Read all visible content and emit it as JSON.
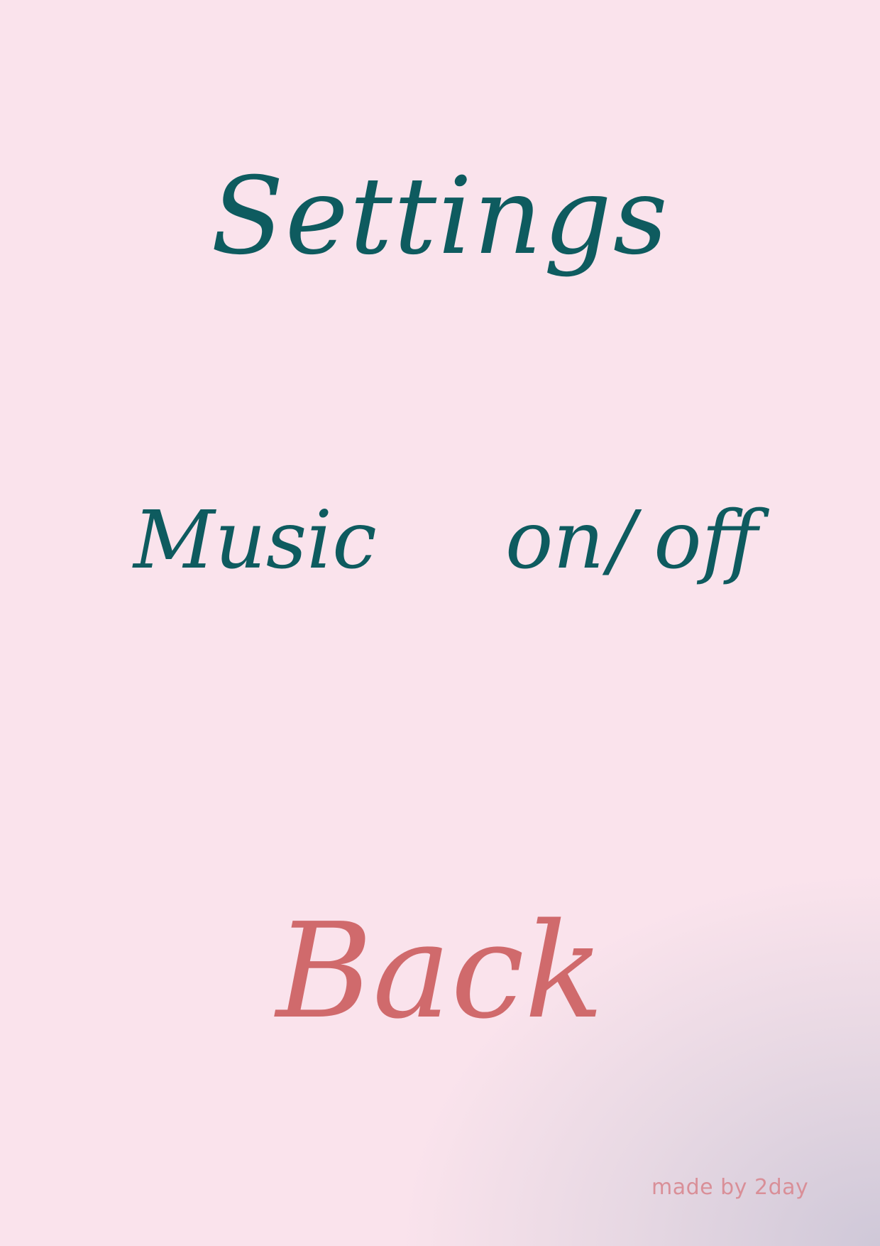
{
  "page": {
    "title": "Settings",
    "music": {
      "label": "Music",
      "on_label": "on",
      "separator": "/",
      "off_label": "off"
    },
    "back_label": "Back",
    "credit": "made by 2day"
  },
  "colors": {
    "background": "#fae3ec",
    "background_corner": "#cfc8d8",
    "primary_text": "#0e5b5f",
    "accent": "#d06a6c",
    "credit_text": "#d98f98"
  }
}
